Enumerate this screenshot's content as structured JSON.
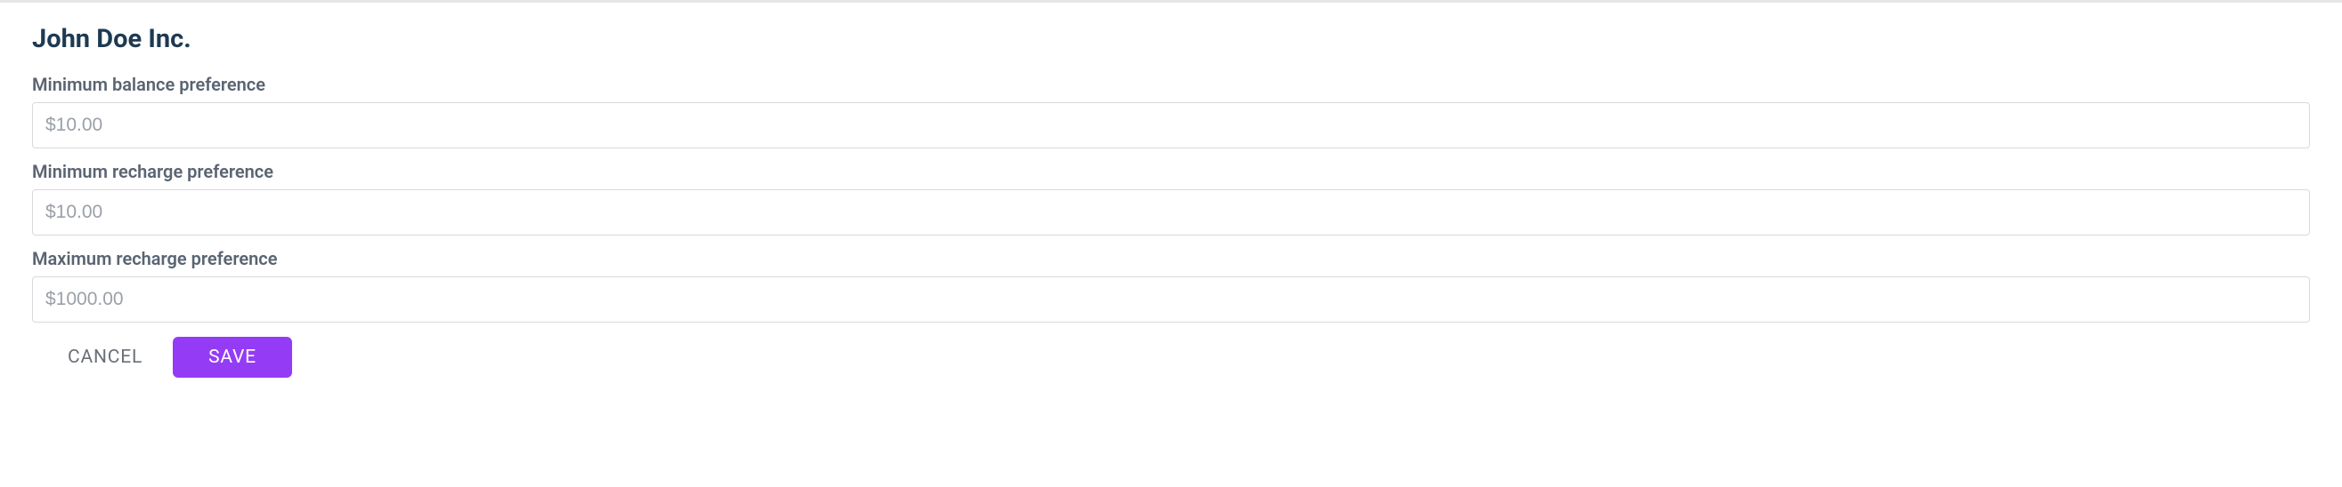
{
  "title": "John Doe Inc.",
  "fields": {
    "minimum_balance": {
      "label": "Minimum balance preference",
      "placeholder": "$10.00",
      "value": ""
    },
    "minimum_recharge": {
      "label": "Minimum recharge preference",
      "placeholder": "$10.00",
      "value": ""
    },
    "maximum_recharge": {
      "label": "Maximum recharge preference",
      "placeholder": "$1000.00",
      "value": ""
    }
  },
  "buttons": {
    "cancel": "CANCEL",
    "save": "SAVE"
  }
}
